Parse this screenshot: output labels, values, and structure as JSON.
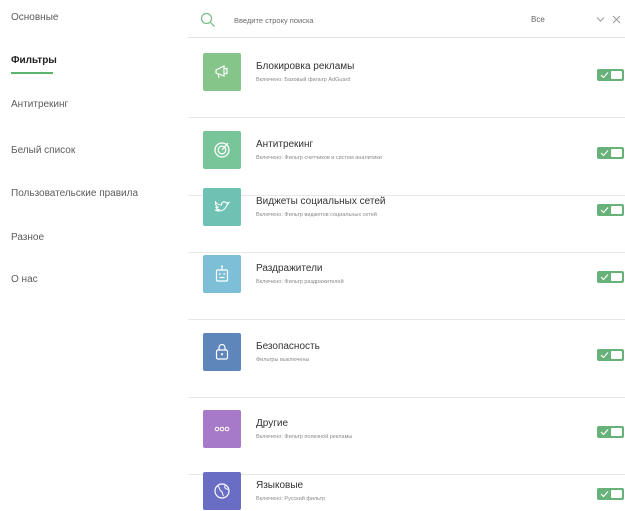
{
  "sidebar": {
    "items": [
      {
        "label": "Основные",
        "active": false
      },
      {
        "label": "Фильтры",
        "active": true
      },
      {
        "label": "Антитрекинг",
        "active": false
      },
      {
        "label": "Белый список",
        "active": false
      },
      {
        "label": "Пользовательские правила",
        "active": false
      },
      {
        "label": "Разное",
        "active": false
      },
      {
        "label": "О нас",
        "active": false
      }
    ]
  },
  "search": {
    "placeholder": "Введите строку поиска",
    "filter_value": "Все",
    "icon": "search-icon"
  },
  "filters": [
    {
      "title": "Блокировка рекламы",
      "subtitle": "Включено: Базовый фильтр AdGuard",
      "color": "#86c58a",
      "icon": "megaphone-icon",
      "enabled": true
    },
    {
      "title": "Антитрекинг",
      "subtitle": "Включено: Фильтр счетчиков и систем аналитики",
      "color": "#79c59a",
      "icon": "target-icon",
      "enabled": true
    },
    {
      "title": "Виджеты социальных сетей",
      "subtitle": "Включено: Фильтр виджетов социальных сетей",
      "color": "#6fc2b3",
      "icon": "bird-icon",
      "enabled": true
    },
    {
      "title": "Раздражители",
      "subtitle": "Включено: Фильтр раздражителей",
      "color": "#7ebfd8",
      "icon": "robot-icon",
      "enabled": true
    },
    {
      "title": "Безопасность",
      "subtitle": "Фильтры выключены",
      "color": "#5f86bb",
      "icon": "lock-icon",
      "enabled": true
    },
    {
      "title": "Другие",
      "subtitle": "Включено: Фильтр полезной рекламы",
      "color": "#a77ac9",
      "icon": "dots-icon",
      "enabled": true
    },
    {
      "title": "Языковые",
      "subtitle": "Включено: Русский фильтр",
      "color": "#6a6dc4",
      "icon": "globe-icon",
      "enabled": true
    }
  ],
  "colors": {
    "accent": "#5eb36e",
    "toggle_on": "#67b279"
  }
}
